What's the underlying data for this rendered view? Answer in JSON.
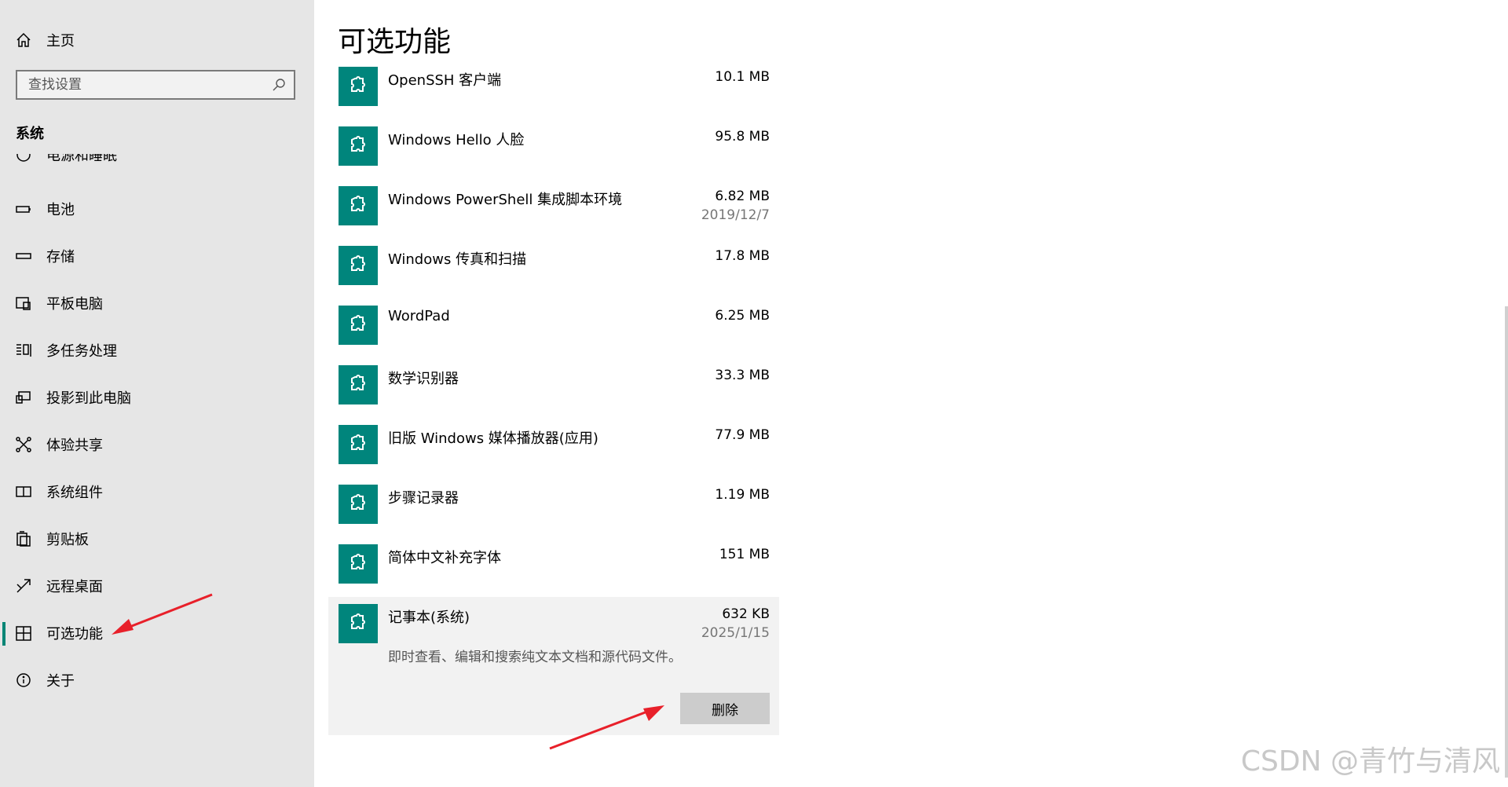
{
  "sidebar": {
    "home_label": "主页",
    "home_icon": "home-icon",
    "search_placeholder": "查找设置",
    "section_title": "系统",
    "partial_item_label": "电源和睡眠",
    "items": [
      {
        "label": "电池",
        "icon": "battery-icon"
      },
      {
        "label": "存储",
        "icon": "storage-icon"
      },
      {
        "label": "平板电脑",
        "icon": "tablet-icon"
      },
      {
        "label": "多任务处理",
        "icon": "multitasking-icon"
      },
      {
        "label": "投影到此电脑",
        "icon": "project-icon"
      },
      {
        "label": "体验共享",
        "icon": "share-icon"
      },
      {
        "label": "系统组件",
        "icon": "components-icon"
      },
      {
        "label": "剪贴板",
        "icon": "clipboard-icon"
      },
      {
        "label": "远程桌面",
        "icon": "remote-desktop-icon"
      },
      {
        "label": "可选功能",
        "icon": "optional-features-icon",
        "selected": true
      },
      {
        "label": "关于",
        "icon": "info-icon"
      }
    ]
  },
  "main": {
    "title": "可选功能",
    "features": [
      {
        "name": "OpenSSH 客户端",
        "size": "10.1 MB"
      },
      {
        "name": "Windows Hello 人脸",
        "size": "95.8 MB"
      },
      {
        "name": "Windows PowerShell 集成脚本环境",
        "size": "6.82 MB",
        "date": "2019/12/7"
      },
      {
        "name": "Windows 传真和扫描",
        "size": "17.8 MB"
      },
      {
        "name": "WordPad",
        "size": "6.25 MB"
      },
      {
        "name": "数学识别器",
        "size": "33.3 MB"
      },
      {
        "name": "旧版 Windows 媒体播放器(应用)",
        "size": "77.9 MB"
      },
      {
        "name": "步骤记录器",
        "size": "1.19 MB"
      },
      {
        "name": "简体中文补充字体",
        "size": "151 MB"
      }
    ],
    "expanded": {
      "name": "记事本(系统)",
      "size": "632 KB",
      "date": "2025/1/15",
      "description": "即时查看、编辑和搜索纯文本文档和源代码文件。",
      "uninstall_label": "删除"
    }
  },
  "colors": {
    "accent": "#008575",
    "icon_bg": "#00857c",
    "annotation_arrow": "#e8202a"
  },
  "watermark": "CSDN @青竹与清风"
}
